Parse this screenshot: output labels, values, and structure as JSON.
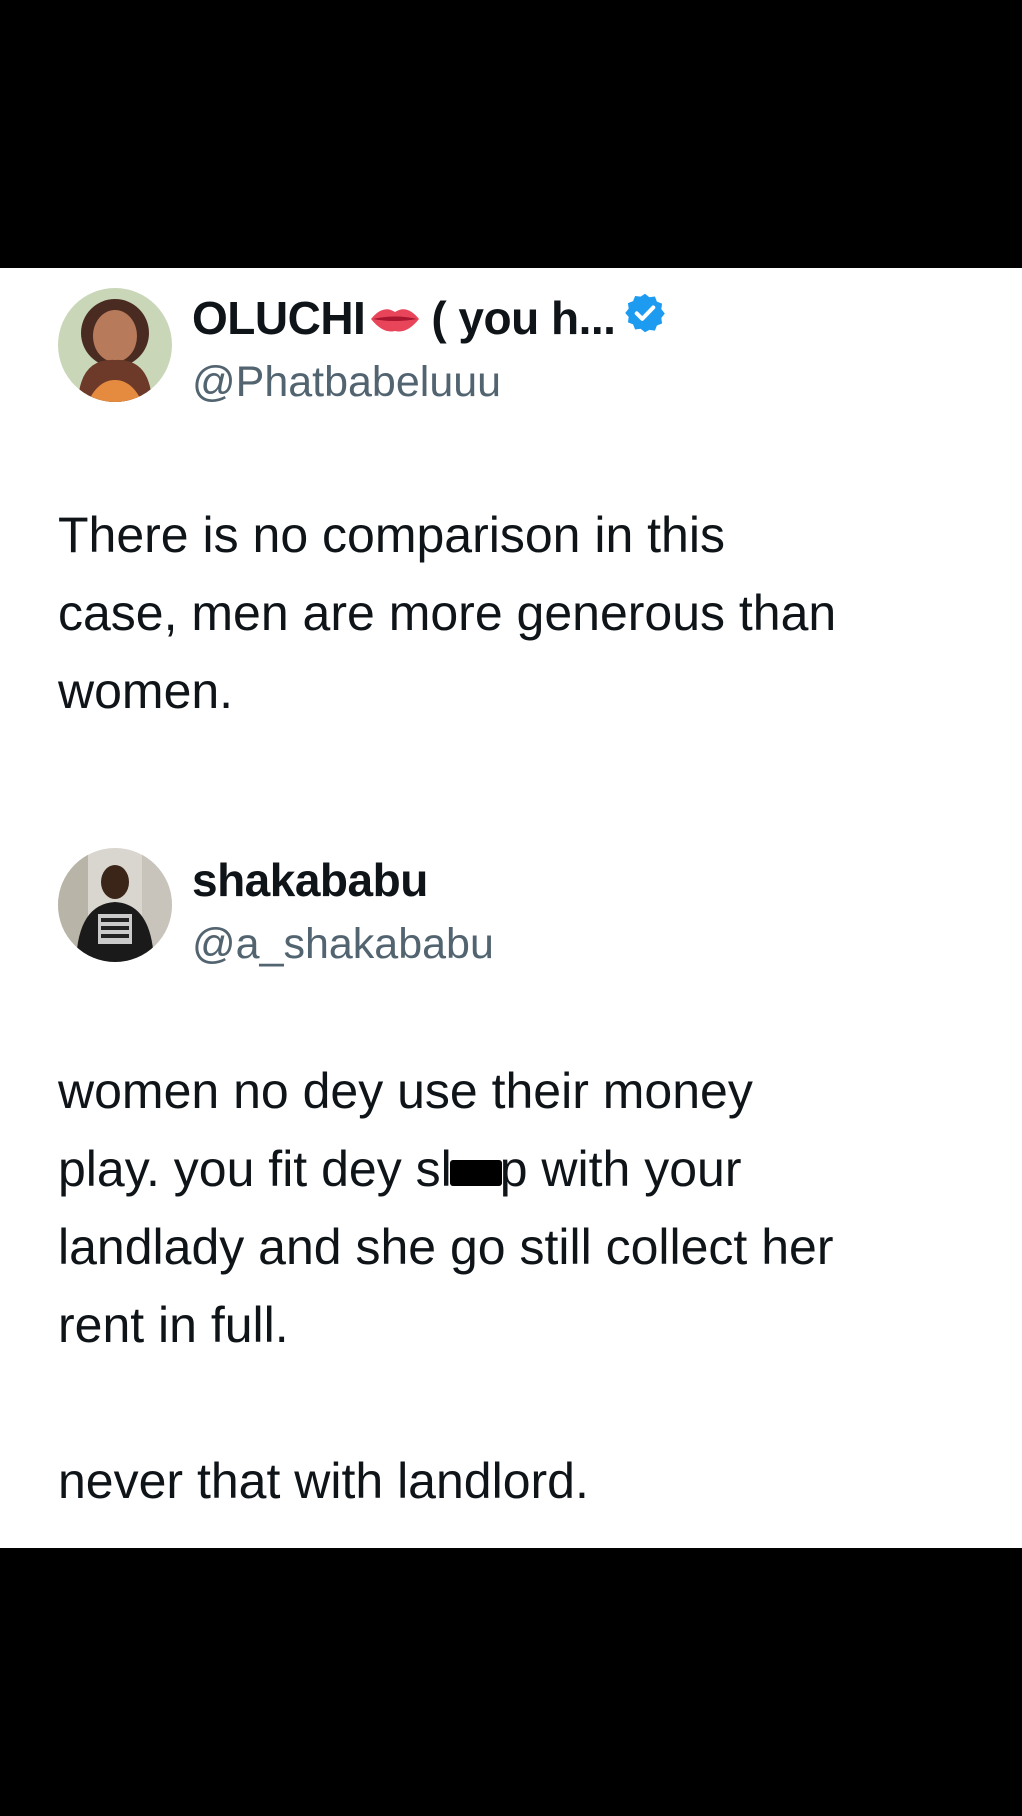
{
  "tweets": [
    {
      "display_name": "OLUCHI",
      "name_suffix": "( you h...",
      "handle": "@Phatbabeluuu",
      "verified": true,
      "text": "There is no comparison in this\ncase, men are more generous than\nwomen."
    },
    {
      "display_name": "shakababu",
      "handle": "@a_shakababu",
      "verified": false,
      "text_before_redaction": "women no dey use their money\nplay. you fit dey sl",
      "text_after_redaction": "p with your\nlandlady and she go still collect her\nrent in full.\n\nnever that with landlord."
    }
  ],
  "colors": {
    "background": "#ffffff",
    "text": "#0f1419",
    "handle": "#536471",
    "verified_badge": "#1d9bf0",
    "letterbox": "#000000"
  },
  "icons": {
    "emoji_after_name": "lips-emoji",
    "badge": "verified-badge-icon"
  }
}
